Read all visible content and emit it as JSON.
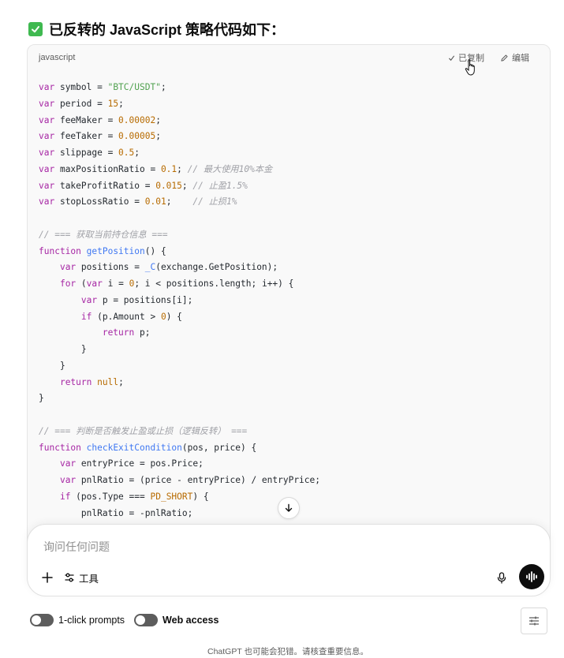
{
  "heading": {
    "check_icon": "check-box-icon",
    "text": "已反转的 JavaScript 策略代码如下："
  },
  "code_block": {
    "language": "javascript",
    "copy_label": "已复制",
    "edit_label": "编辑",
    "lines": {
      "l1_var": "var",
      "l1_rest": " symbol = ",
      "l1_str": "\"BTC/USDT\"",
      "l1_end": ";",
      "l2_var": "var",
      "l2_rest": " period = ",
      "l2_num": "15",
      "l2_end": ";",
      "l3_var": "var",
      "l3_rest": " feeMaker = ",
      "l3_num": "0.00002",
      "l3_end": ";",
      "l4_var": "var",
      "l4_rest": " feeTaker = ",
      "l4_num": "0.00005",
      "l4_end": ";",
      "l5_var": "var",
      "l5_rest": " slippage = ",
      "l5_num": "0.5",
      "l5_end": ";",
      "l6_var": "var",
      "l6_rest": " maxPositionRatio = ",
      "l6_num": "0.1",
      "l6_end": "; ",
      "l6_cmt": "// 最大使用10%本金",
      "l7_var": "var",
      "l7_rest": " takeProfitRatio = ",
      "l7_num": "0.015",
      "l7_end": "; ",
      "l7_cmt": "// 止盈1.5%",
      "l8_var": "var",
      "l8_rest": " stopLossRatio = ",
      "l8_num": "0.01",
      "l8_end": ";    ",
      "l8_cmt": "// 止损1%",
      "l10_cmt": "// === 获取当前持仓信息 ===",
      "l11_kw": "function",
      "l11_fn": "getPosition",
      "l11_rest": "() {",
      "l12_ind": "    ",
      "l12_var": "var",
      "l12_rest": " positions = ",
      "l12_fn": "_C",
      "l12_end": "(exchange.GetPosition);",
      "l13_ind": "    ",
      "l13_kw": "for",
      "l13_a": " (",
      "l13_var": "var",
      "l13_b": " i = ",
      "l13_num": "0",
      "l13_c": "; i < positions.length; i++) {",
      "l14_ind": "        ",
      "l14_var": "var",
      "l14_rest": " p = positions[i];",
      "l15_ind": "        ",
      "l15_kw": "if",
      "l15_a": " (p.Amount > ",
      "l15_num": "0",
      "l15_b": ") {",
      "l16_ind": "            ",
      "l16_kw": "return",
      "l16_rest": " p;",
      "l17": "        }",
      "l18": "    }",
      "l19_ind": "    ",
      "l19_kw": "return",
      "l19_sp": " ",
      "l19_null": "null",
      "l19_end": ";",
      "l20": "}",
      "l22_cmt": "// === 判断是否触发止盈或止损（逻辑反转） ===",
      "l23_kw": "function",
      "l23_fn": "checkExitCondition",
      "l23_rest": "(pos, price) {",
      "l24_ind": "    ",
      "l24_var": "var",
      "l24_rest": " entryPrice = pos.Price;",
      "l25_ind": "    ",
      "l25_var": "var",
      "l25_rest": " pnlRatio = (price - entryPrice) / entryPrice;",
      "l26_ind": "    ",
      "l26_kw": "if",
      "l26_a": " (pos.Type === ",
      "l26_cn": "PD_SHORT",
      "l26_b": ") {",
      "l27": "        pnlRatio = -pnlRatio;"
    }
  },
  "composer": {
    "placeholder": "询问任何问题",
    "tools_label": "工具"
  },
  "toggles": [
    {
      "label": "1-click prompts",
      "state": "off"
    },
    {
      "label": "Web access",
      "state": "off"
    }
  ],
  "footer": "ChatGPT 也可能会犯错。请核查重要信息。",
  "colors": {
    "keyword": "#a626a4",
    "string": "#50a14f",
    "number": "#b76b01",
    "comment": "#a0a1a7",
    "function": "#4078f2",
    "check_green": "#3fb950"
  }
}
